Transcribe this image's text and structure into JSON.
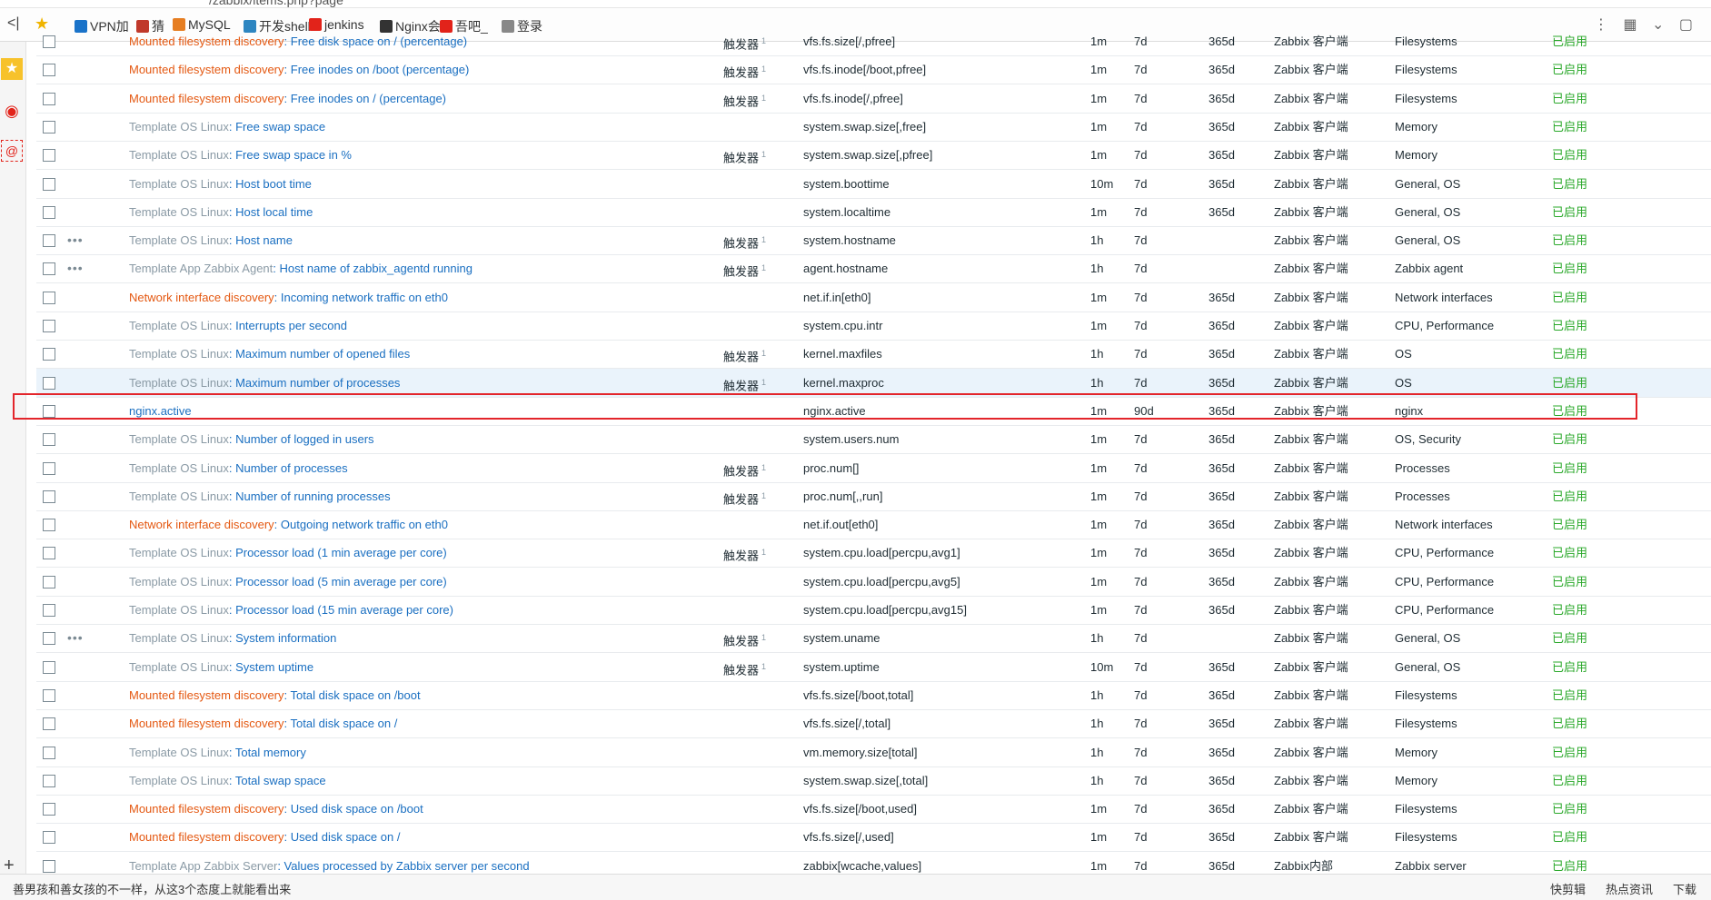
{
  "browser": {
    "url_fragment": "/zabbix/items.php?page",
    "back_label": "<|",
    "bookmarks": [
      {
        "label": "VPN加",
        "color": "#1a73c9"
      },
      {
        "label": "猜",
        "color": "#c0392b"
      },
      {
        "label": "MySQL",
        "color": "#e67e22"
      },
      {
        "label": "开发shell",
        "color": "#2e86c1"
      },
      {
        "label": "jenkins",
        "color": "#e2231a"
      },
      {
        "label": "Nginx会",
        "color": "#333333"
      },
      {
        "label": "吾吧_",
        "color": "#e2231a"
      },
      {
        "label": "登录",
        "color": "#888888"
      }
    ]
  },
  "table": {
    "rows": [
      {
        "prefix": "Mounted filesystem discovery",
        "prefix_type": "discovery",
        "name": "Free disk space on / (percentage)",
        "triggers": "触发器",
        "trigger_count": "1",
        "key": "vfs.fs.size[/,pfree]",
        "interval": "1m",
        "history": "7d",
        "trends": "365d",
        "type": "Zabbix 客户端",
        "app": "Filesystems",
        "status": "已启用",
        "dots": false
      },
      {
        "prefix": "Mounted filesystem discovery",
        "prefix_type": "discovery",
        "name": "Free inodes on /boot (percentage)",
        "triggers": "触发器",
        "trigger_count": "1",
        "key": "vfs.fs.inode[/boot,pfree]",
        "interval": "1m",
        "history": "7d",
        "trends": "365d",
        "type": "Zabbix 客户端",
        "app": "Filesystems",
        "status": "已启用",
        "dots": false
      },
      {
        "prefix": "Mounted filesystem discovery",
        "prefix_type": "discovery",
        "name": "Free inodes on / (percentage)",
        "triggers": "触发器",
        "trigger_count": "1",
        "key": "vfs.fs.inode[/,pfree]",
        "interval": "1m",
        "history": "7d",
        "trends": "365d",
        "type": "Zabbix 客户端",
        "app": "Filesystems",
        "status": "已启用",
        "dots": false
      },
      {
        "prefix": "Template OS Linux",
        "prefix_type": "template",
        "name": "Free swap space",
        "triggers": "",
        "trigger_count": "",
        "key": "system.swap.size[,free]",
        "interval": "1m",
        "history": "7d",
        "trends": "365d",
        "type": "Zabbix 客户端",
        "app": "Memory",
        "status": "已启用",
        "dots": false
      },
      {
        "prefix": "Template OS Linux",
        "prefix_type": "template",
        "name": "Free swap space in %",
        "triggers": "触发器",
        "trigger_count": "1",
        "key": "system.swap.size[,pfree]",
        "interval": "1m",
        "history": "7d",
        "trends": "365d",
        "type": "Zabbix 客户端",
        "app": "Memory",
        "status": "已启用",
        "dots": false
      },
      {
        "prefix": "Template OS Linux",
        "prefix_type": "template",
        "name": "Host boot time",
        "triggers": "",
        "trigger_count": "",
        "key": "system.boottime",
        "interval": "10m",
        "history": "7d",
        "trends": "365d",
        "type": "Zabbix 客户端",
        "app": "General, OS",
        "status": "已启用",
        "dots": false
      },
      {
        "prefix": "Template OS Linux",
        "prefix_type": "template",
        "name": "Host local time",
        "triggers": "",
        "trigger_count": "",
        "key": "system.localtime",
        "interval": "1m",
        "history": "7d",
        "trends": "365d",
        "type": "Zabbix 客户端",
        "app": "General, OS",
        "status": "已启用",
        "dots": false
      },
      {
        "prefix": "Template OS Linux",
        "prefix_type": "template",
        "name": "Host name",
        "triggers": "触发器",
        "trigger_count": "1",
        "key": "system.hostname",
        "interval": "1h",
        "history": "7d",
        "trends": "",
        "type": "Zabbix 客户端",
        "app": "General, OS",
        "status": "已启用",
        "dots": true
      },
      {
        "prefix": "Template App Zabbix Agent",
        "prefix_type": "template",
        "name": "Host name of zabbix_agentd running",
        "triggers": "触发器",
        "trigger_count": "1",
        "key": "agent.hostname",
        "interval": "1h",
        "history": "7d",
        "trends": "",
        "type": "Zabbix 客户端",
        "app": "Zabbix agent",
        "status": "已启用",
        "dots": true
      },
      {
        "prefix": "Network interface discovery",
        "prefix_type": "discovery",
        "name": "Incoming network traffic on eth0",
        "triggers": "",
        "trigger_count": "",
        "key": "net.if.in[eth0]",
        "interval": "1m",
        "history": "7d",
        "trends": "365d",
        "type": "Zabbix 客户端",
        "app": "Network interfaces",
        "status": "已启用",
        "dots": false
      },
      {
        "prefix": "Template OS Linux",
        "prefix_type": "template",
        "name": "Interrupts per second",
        "triggers": "",
        "trigger_count": "",
        "key": "system.cpu.intr",
        "interval": "1m",
        "history": "7d",
        "trends": "365d",
        "type": "Zabbix 客户端",
        "app": "CPU, Performance",
        "status": "已启用",
        "dots": false
      },
      {
        "prefix": "Template OS Linux",
        "prefix_type": "template",
        "name": "Maximum number of opened files",
        "triggers": "触发器",
        "trigger_count": "1",
        "key": "kernel.maxfiles",
        "interval": "1h",
        "history": "7d",
        "trends": "365d",
        "type": "Zabbix 客户端",
        "app": "OS",
        "status": "已启用",
        "dots": false
      },
      {
        "prefix": "Template OS Linux",
        "prefix_type": "template",
        "name": "Maximum number of processes",
        "triggers": "触发器",
        "trigger_count": "1",
        "key": "kernel.maxproc",
        "interval": "1h",
        "history": "7d",
        "trends": "365d",
        "type": "Zabbix 客户端",
        "app": "OS",
        "status": "已启用",
        "dots": false,
        "highlight": true
      },
      {
        "prefix": "",
        "prefix_type": "none",
        "name": "nginx.active",
        "triggers": "",
        "trigger_count": "",
        "key": "nginx.active",
        "interval": "1m",
        "history": "90d",
        "trends": "365d",
        "type": "Zabbix 客户端",
        "app": "nginx",
        "status": "已启用",
        "dots": false
      },
      {
        "prefix": "Template OS Linux",
        "prefix_type": "template",
        "name": "Number of logged in users",
        "triggers": "",
        "trigger_count": "",
        "key": "system.users.num",
        "interval": "1m",
        "history": "7d",
        "trends": "365d",
        "type": "Zabbix 客户端",
        "app": "OS, Security",
        "status": "已启用",
        "dots": false
      },
      {
        "prefix": "Template OS Linux",
        "prefix_type": "template",
        "name": "Number of processes",
        "triggers": "触发器",
        "trigger_count": "1",
        "key": "proc.num[]",
        "interval": "1m",
        "history": "7d",
        "trends": "365d",
        "type": "Zabbix 客户端",
        "app": "Processes",
        "status": "已启用",
        "dots": false
      },
      {
        "prefix": "Template OS Linux",
        "prefix_type": "template",
        "name": "Number of running processes",
        "triggers": "触发器",
        "trigger_count": "1",
        "key": "proc.num[,,run]",
        "interval": "1m",
        "history": "7d",
        "trends": "365d",
        "type": "Zabbix 客户端",
        "app": "Processes",
        "status": "已启用",
        "dots": false
      },
      {
        "prefix": "Network interface discovery",
        "prefix_type": "discovery",
        "name": "Outgoing network traffic on eth0",
        "triggers": "",
        "trigger_count": "",
        "key": "net.if.out[eth0]",
        "interval": "1m",
        "history": "7d",
        "trends": "365d",
        "type": "Zabbix 客户端",
        "app": "Network interfaces",
        "status": "已启用",
        "dots": false
      },
      {
        "prefix": "Template OS Linux",
        "prefix_type": "template",
        "name": "Processor load (1 min average per core)",
        "triggers": "触发器",
        "trigger_count": "1",
        "key": "system.cpu.load[percpu,avg1]",
        "interval": "1m",
        "history": "7d",
        "trends": "365d",
        "type": "Zabbix 客户端",
        "app": "CPU, Performance",
        "status": "已启用",
        "dots": false
      },
      {
        "prefix": "Template OS Linux",
        "prefix_type": "template",
        "name": "Processor load (5 min average per core)",
        "triggers": "",
        "trigger_count": "",
        "key": "system.cpu.load[percpu,avg5]",
        "interval": "1m",
        "history": "7d",
        "trends": "365d",
        "type": "Zabbix 客户端",
        "app": "CPU, Performance",
        "status": "已启用",
        "dots": false
      },
      {
        "prefix": "Template OS Linux",
        "prefix_type": "template",
        "name": "Processor load (15 min average per core)",
        "triggers": "",
        "trigger_count": "",
        "key": "system.cpu.load[percpu,avg15]",
        "interval": "1m",
        "history": "7d",
        "trends": "365d",
        "type": "Zabbix 客户端",
        "app": "CPU, Performance",
        "status": "已启用",
        "dots": false
      },
      {
        "prefix": "Template OS Linux",
        "prefix_type": "template",
        "name": "System information",
        "triggers": "触发器",
        "trigger_count": "1",
        "key": "system.uname",
        "interval": "1h",
        "history": "7d",
        "trends": "",
        "type": "Zabbix 客户端",
        "app": "General, OS",
        "status": "已启用",
        "dots": true
      },
      {
        "prefix": "Template OS Linux",
        "prefix_type": "template",
        "name": "System uptime",
        "triggers": "触发器",
        "trigger_count": "1",
        "key": "system.uptime",
        "interval": "10m",
        "history": "7d",
        "trends": "365d",
        "type": "Zabbix 客户端",
        "app": "General, OS",
        "status": "已启用",
        "dots": false
      },
      {
        "prefix": "Mounted filesystem discovery",
        "prefix_type": "discovery",
        "name": "Total disk space on /boot",
        "triggers": "",
        "trigger_count": "",
        "key": "vfs.fs.size[/boot,total]",
        "interval": "1h",
        "history": "7d",
        "trends": "365d",
        "type": "Zabbix 客户端",
        "app": "Filesystems",
        "status": "已启用",
        "dots": false
      },
      {
        "prefix": "Mounted filesystem discovery",
        "prefix_type": "discovery",
        "name": "Total disk space on /",
        "triggers": "",
        "trigger_count": "",
        "key": "vfs.fs.size[/,total]",
        "interval": "1h",
        "history": "7d",
        "trends": "365d",
        "type": "Zabbix 客户端",
        "app": "Filesystems",
        "status": "已启用",
        "dots": false
      },
      {
        "prefix": "Template OS Linux",
        "prefix_type": "template",
        "name": "Total memory",
        "triggers": "",
        "trigger_count": "",
        "key": "vm.memory.size[total]",
        "interval": "1h",
        "history": "7d",
        "trends": "365d",
        "type": "Zabbix 客户端",
        "app": "Memory",
        "status": "已启用",
        "dots": false
      },
      {
        "prefix": "Template OS Linux",
        "prefix_type": "template",
        "name": "Total swap space",
        "triggers": "",
        "trigger_count": "",
        "key": "system.swap.size[,total]",
        "interval": "1h",
        "history": "7d",
        "trends": "365d",
        "type": "Zabbix 客户端",
        "app": "Memory",
        "status": "已启用",
        "dots": false
      },
      {
        "prefix": "Mounted filesystem discovery",
        "prefix_type": "discovery",
        "name": "Used disk space on /boot",
        "triggers": "",
        "trigger_count": "",
        "key": "vfs.fs.size[/boot,used]",
        "interval": "1m",
        "history": "7d",
        "trends": "365d",
        "type": "Zabbix 客户端",
        "app": "Filesystems",
        "status": "已启用",
        "dots": false
      },
      {
        "prefix": "Mounted filesystem discovery",
        "prefix_type": "discovery",
        "name": "Used disk space on /",
        "triggers": "",
        "trigger_count": "",
        "key": "vfs.fs.size[/,used]",
        "interval": "1m",
        "history": "7d",
        "trends": "365d",
        "type": "Zabbix 客户端",
        "app": "Filesystems",
        "status": "已启用",
        "dots": false
      },
      {
        "prefix": "Template App Zabbix Server",
        "prefix_type": "template",
        "name": "Values processed by Zabbix server per second",
        "triggers": "",
        "trigger_count": "",
        "key": "zabbix[wcache,values]",
        "interval": "1m",
        "history": "7d",
        "trends": "365d",
        "type": "Zabbix内部",
        "app": "Zabbix server",
        "status": "已启用",
        "dots": false
      }
    ]
  },
  "statusbar": {
    "news": "善男孩和善女孩的不一样，从这3个态度上就能看出来",
    "tools": [
      "快剪辑",
      "热点资讯",
      "下载"
    ]
  },
  "colors": {
    "template_prefix": "#8a9aa5",
    "discovery_prefix": "#e45811",
    "item_link": "#1a6fc1",
    "status_enabled": "#2aa82a",
    "highlight_box": "#e3252b"
  }
}
